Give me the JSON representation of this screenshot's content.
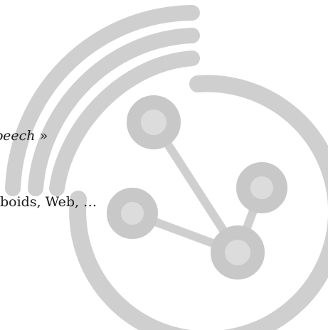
{
  "snippet": {
    "line1_italic": "peech",
    "line1_suffix": " »",
    "line2": "boids, Web, …"
  },
  "logo": {
    "icon": "network-graph-logo",
    "arc_color": "#cfcfcf",
    "node_fill": "#dcdcdc",
    "node_stroke": "#c8c8c8"
  }
}
